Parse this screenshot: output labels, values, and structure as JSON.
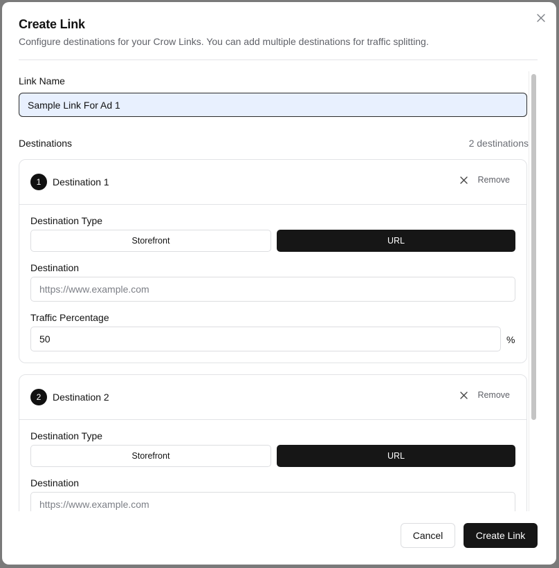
{
  "dialog": {
    "title": "Create Link",
    "subtitle": "Configure destinations for your Crow Links. You can add multiple destinations for traffic splitting.",
    "close_icon": "x-icon"
  },
  "form": {
    "link_name_label": "Link Name",
    "link_name_value": "Sample Link For Ad 1",
    "destinations_label": "Destinations",
    "destinations_count": "2 destinations"
  },
  "destinations": [
    {
      "number": "1",
      "title": "Destination 1",
      "remove_label": "Remove",
      "type_label": "Destination Type",
      "type_options": [
        "Storefront",
        "URL"
      ],
      "selected_type": "URL",
      "destination_label": "Destination",
      "destination_placeholder": "https://www.example.com",
      "traffic_label": "Traffic Percentage",
      "traffic_value": "50",
      "traffic_unit": "%"
    },
    {
      "number": "2",
      "title": "Destination 2",
      "remove_label": "Remove",
      "type_label": "Destination Type",
      "type_options": [
        "Storefront",
        "URL"
      ],
      "selected_type": "URL",
      "destination_label": "Destination",
      "destination_placeholder": "https://www.example.com"
    }
  ],
  "footer": {
    "cancel_label": "Cancel",
    "create_label": "Create Link"
  },
  "colors": {
    "primary": "#161616",
    "input_autofill": "#e8f0fe",
    "border": "#e2e3e6",
    "muted_text": "#5f6168"
  }
}
